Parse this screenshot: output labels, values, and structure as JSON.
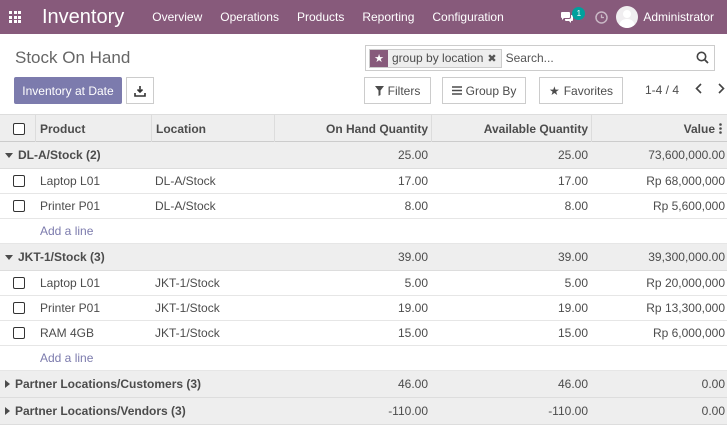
{
  "navbar": {
    "brand": "Inventory",
    "menu": [
      "Overview",
      "Operations",
      "Products",
      "Reporting",
      "Configuration"
    ],
    "chat_badge": "1",
    "user_name": "Administrator",
    "bg_color": "#875a7b"
  },
  "control_panel": {
    "title": "Stock On Hand",
    "search": {
      "facet_label": "group by location",
      "placeholder": "Search..."
    },
    "buttons": {
      "inventory_at_date": "Inventory at Date",
      "filters": "Filters",
      "group_by": "Group By",
      "favorites": "Favorites"
    },
    "pager": "1-4 / 4"
  },
  "table": {
    "headers": {
      "product": "Product",
      "location": "Location",
      "on_hand": "On Hand Quantity",
      "available": "Available Quantity",
      "value": "Value"
    },
    "add_line": "Add a line",
    "groups": [
      {
        "label": "DL-A/Stock (2)",
        "expanded": true,
        "on_hand": "25.00",
        "available": "25.00",
        "value": "73,600,000.00",
        "rows": [
          {
            "product": "Laptop L01",
            "location": "DL-A/Stock",
            "on_hand": "17.00",
            "available": "17.00",
            "value": "Rp 68,000,000"
          },
          {
            "product": "Printer P01",
            "location": "DL-A/Stock",
            "on_hand": "8.00",
            "available": "8.00",
            "value": "Rp 5,600,000"
          }
        ]
      },
      {
        "label": "JKT-1/Stock (3)",
        "expanded": true,
        "on_hand": "39.00",
        "available": "39.00",
        "value": "39,300,000.00",
        "rows": [
          {
            "product": "Laptop L01",
            "location": "JKT-1/Stock",
            "on_hand": "5.00",
            "available": "5.00",
            "value": "Rp 20,000,000"
          },
          {
            "product": "Printer P01",
            "location": "JKT-1/Stock",
            "on_hand": "19.00",
            "available": "19.00",
            "value": "Rp 13,300,000"
          },
          {
            "product": "RAM 4GB",
            "location": "JKT-1/Stock",
            "on_hand": "15.00",
            "available": "15.00",
            "value": "Rp 6,000,000"
          }
        ]
      },
      {
        "label": "Partner Locations/Customers (3)",
        "expanded": false,
        "on_hand": "46.00",
        "available": "46.00",
        "value": "0.00",
        "rows": []
      },
      {
        "label": "Partner Locations/Vendors (3)",
        "expanded": false,
        "on_hand": "-110.00",
        "available": "-110.00",
        "value": "0.00",
        "rows": []
      }
    ]
  }
}
